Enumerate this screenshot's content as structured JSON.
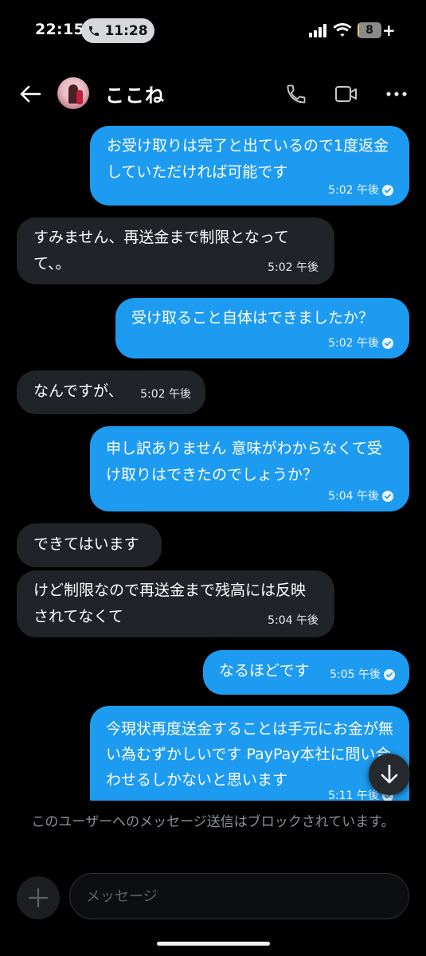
{
  "status_bar": {
    "time": "22:15",
    "call_duration": "11:28",
    "battery_level": "8",
    "battery_fraction": 0.08,
    "charging_symbol": "+"
  },
  "header": {
    "contact_name": "ここね",
    "icons": [
      "back-arrow-icon",
      "phone-icon",
      "video-icon",
      "more-icon"
    ]
  },
  "messages": [
    {
      "direction": "out",
      "text": "お受け取りは完了と出ているので1度返金していただければ可能です",
      "time": "5:02 午後",
      "read": true
    },
    {
      "direction": "in",
      "text": "すみません、再送金まで制限となってて、。",
      "time": "5:02 午後"
    },
    {
      "direction": "out",
      "text": "受け取ること自体はできましたか？",
      "time": "5:02 午後",
      "read": true
    },
    {
      "direction": "in",
      "text": "なんですが、",
      "time": "5:02 午後"
    },
    {
      "direction": "out",
      "text": "申し訳ありません 意味がわからなくて受け取りはできたのでしょうか？",
      "time": "5:04 午後",
      "read": true
    },
    {
      "direction": "in",
      "text": "できてはいます",
      "time": ""
    },
    {
      "direction": "in",
      "text": "けど制限なので再送金まで残高には反映されてなくて",
      "time": "5:04 午後"
    },
    {
      "direction": "out",
      "text": "なるほどです",
      "time": "5:05 午後",
      "read": true
    },
    {
      "direction": "out",
      "text": "今現状再度送金することは手元にお金が無い為むずかしいです PayPay本社に問い合わせるしかないと思います",
      "time": "5:11 午後",
      "read": true
    }
  ],
  "blocked_notice": "このユーザーへのメッセージ送信はブロックされています。",
  "composer": {
    "placeholder": "メッセージ"
  },
  "colors": {
    "outgoing_bubble": "#1d9bf0",
    "incoming_bubble": "#202327",
    "background": "#000000"
  }
}
